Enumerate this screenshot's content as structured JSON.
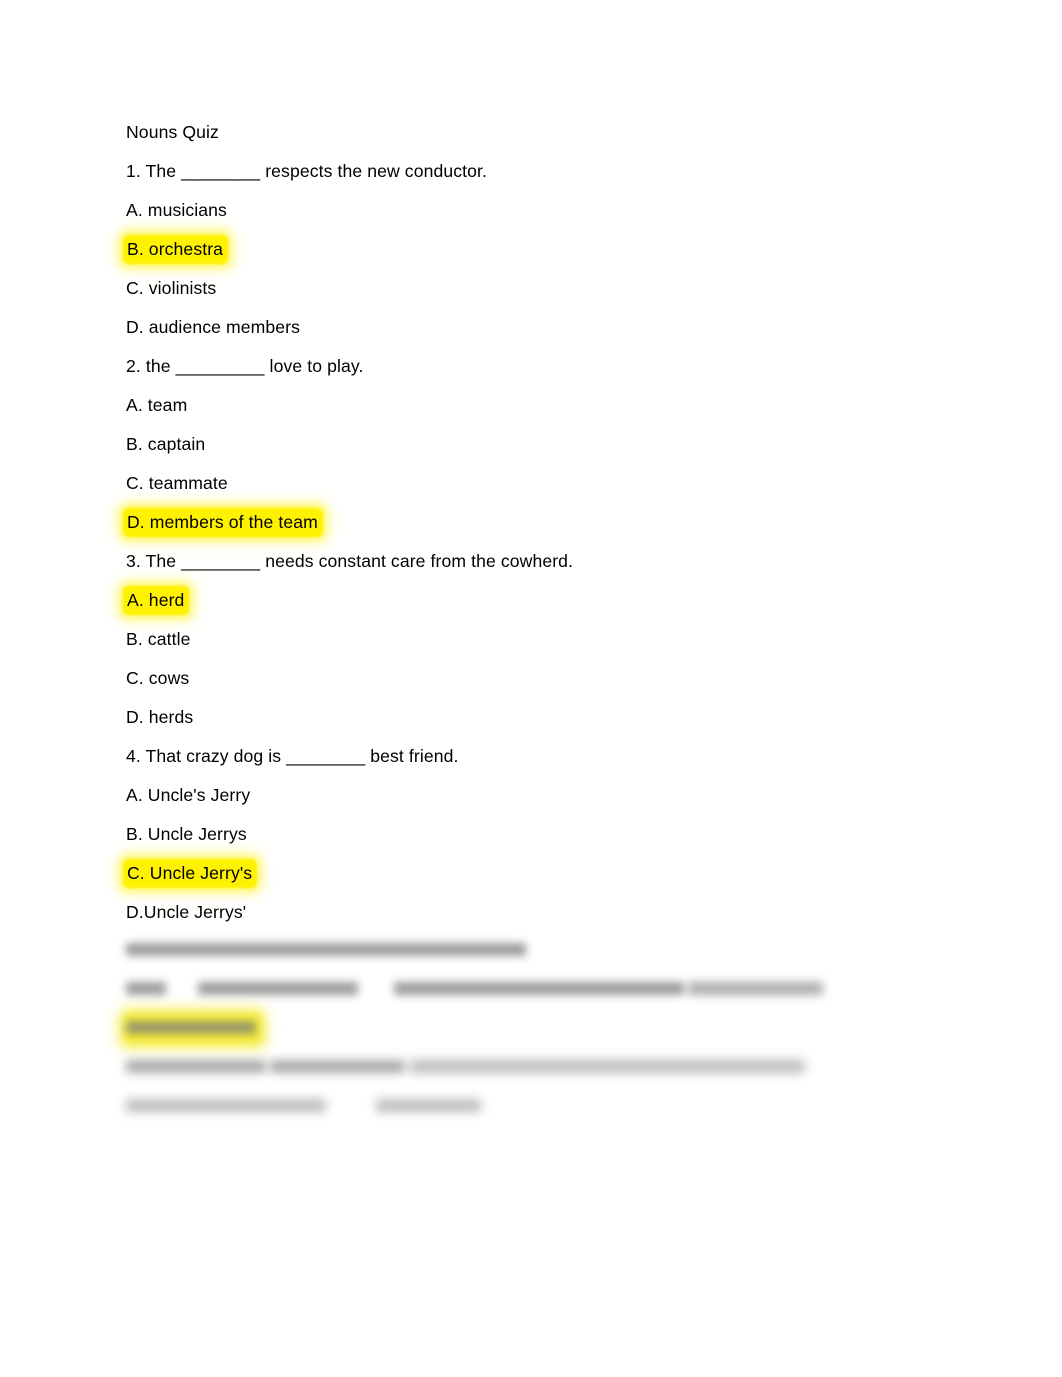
{
  "document": {
    "title": "Nouns Quiz",
    "page_background": "#ffffff",
    "text_color": "#000000",
    "highlight_color": "#fff200"
  },
  "content": {
    "heading": "Nouns Quiz",
    "questions": [
      {
        "stem": "1. The ________ respects the new conductor.",
        "options": [
          {
            "label": "A. musicians",
            "highlighted": false
          },
          {
            "label": "B. orchestra",
            "highlighted": true
          },
          {
            "label": "C. violinists",
            "highlighted": false
          },
          {
            "label": "D. audience members",
            "highlighted": false
          }
        ]
      },
      {
        "stem": "2. the _________ love to play.",
        "options": [
          {
            "label": "A. team",
            "highlighted": false
          },
          {
            "label": "B. captain",
            "highlighted": false
          },
          {
            "label": "C. teammate",
            "highlighted": false
          },
          {
            "label": "D. members of the team",
            "highlighted": true
          }
        ]
      },
      {
        "stem": "3. The ________ needs constant care from the cowherd.",
        "options": [
          {
            "label": "A. herd",
            "highlighted": true
          },
          {
            "label": "B. cattle",
            "highlighted": false
          },
          {
            "label": "C. cows",
            "highlighted": false
          },
          {
            "label": "D. herds",
            "highlighted": false
          }
        ]
      },
      {
        "stem": "4. That crazy dog is ________ best friend.",
        "options": [
          {
            "label": "A. Uncle's Jerry",
            "highlighted": false
          },
          {
            "label": "B. Uncle Jerrys",
            "highlighted": false
          },
          {
            "label": "C. Uncle Jerry's",
            "highlighted": true
          },
          {
            "label": "D.Uncle Jerrys'",
            "highlighted": false
          }
        ]
      }
    ],
    "blurred_section": {
      "note": "Lower portion of the page is blurred/illegible in the screenshot; text cannot be read.",
      "lines": [
        {
          "text": " ",
          "highlighted": false
        },
        {
          "text": " ",
          "highlighted": false
        },
        {
          "text": " ",
          "highlighted": false
        },
        {
          "text": " ",
          "highlighted": true
        },
        {
          "text": " ",
          "highlighted": false
        },
        {
          "text": " ",
          "highlighted": false
        },
        {
          "text": " ",
          "highlighted": false
        },
        {
          "text": " ",
          "highlighted": false
        }
      ]
    }
  }
}
